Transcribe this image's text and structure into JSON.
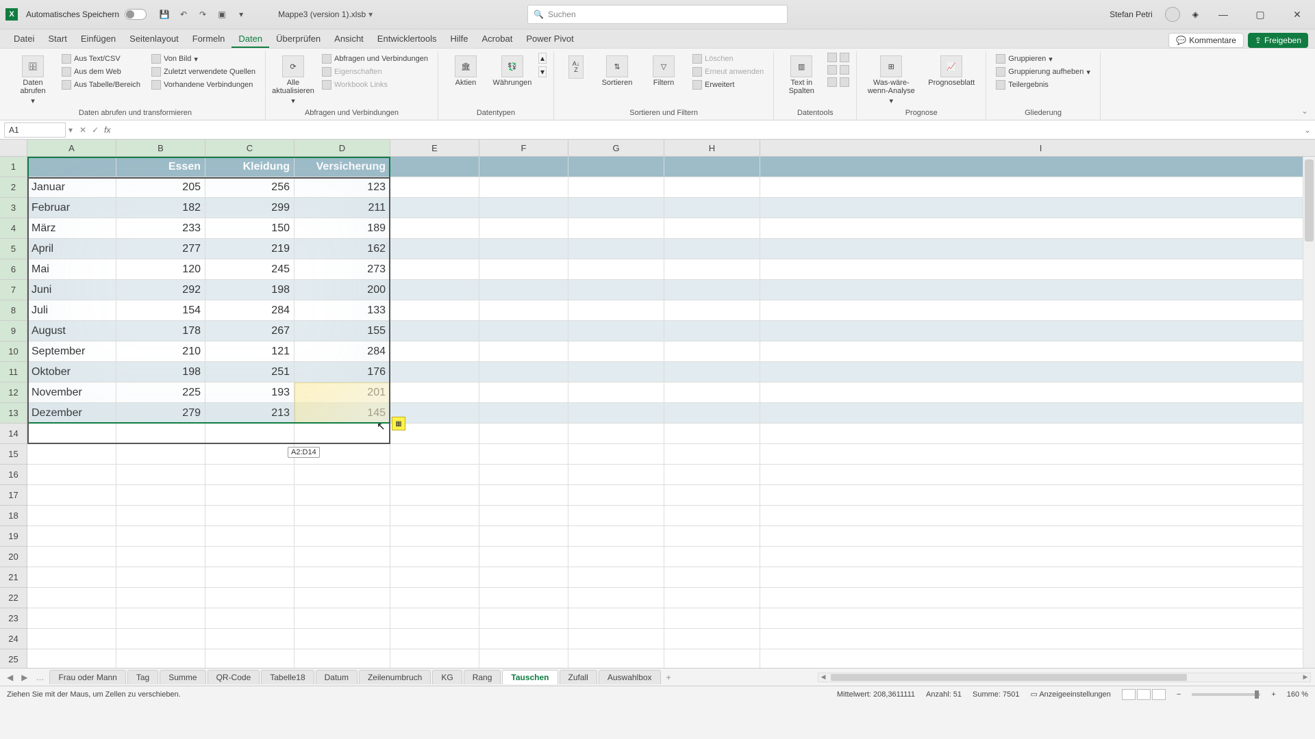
{
  "title": {
    "autosave": "Automatisches Speichern",
    "filename": "Mappe3 (version 1).xlsb",
    "search_placeholder": "Suchen",
    "user": "Stefan Petri"
  },
  "tabs": [
    "Datei",
    "Start",
    "Einfügen",
    "Seitenlayout",
    "Formeln",
    "Daten",
    "Überprüfen",
    "Ansicht",
    "Entwicklertools",
    "Hilfe",
    "Acrobat",
    "Power Pivot"
  ],
  "active_tab": "Daten",
  "tabs_right": {
    "comments": "Kommentare",
    "share": "Freigeben"
  },
  "ribbon": {
    "g1": {
      "big": "Daten abrufen",
      "items": [
        "Aus Text/CSV",
        "Aus dem Web",
        "Aus Tabelle/Bereich"
      ],
      "label": "Daten abrufen und transformieren",
      "items2": [
        "Von Bild",
        "Zuletzt verwendete Quellen",
        "Vorhandene Verbindungen"
      ]
    },
    "g2": {
      "big": "Alle aktualisieren",
      "items": [
        "Abfragen und Verbindungen",
        "Eigenschaften",
        "Workbook Links"
      ],
      "label": "Abfragen und Verbindungen"
    },
    "g3": {
      "btn1": "Aktien",
      "btn2": "Währungen",
      "label": "Datentypen"
    },
    "g4": {
      "btn1": "Sortieren",
      "btn2": "Filtern",
      "items": [
        "Löschen",
        "Erneut anwenden",
        "Erweitert"
      ],
      "label": "Sortieren und Filtern"
    },
    "g5": {
      "big": "Text in Spalten",
      "label": "Datentools"
    },
    "g6": {
      "btn1": "Was-wäre-wenn-Analyse",
      "btn2": "Prognoseblatt",
      "label": "Prognose"
    },
    "g7": {
      "items": [
        "Gruppieren",
        "Gruppierung aufheben",
        "Teilergebnis"
      ],
      "label": "Gliederung"
    }
  },
  "formula": {
    "name_box": "A1",
    "fx": "fx"
  },
  "grid": {
    "col_widths": {
      "A": 130,
      "B": 130,
      "C": 130,
      "D": 140,
      "E": 130,
      "F": 130,
      "G": 140,
      "H": 140,
      "I": 820
    },
    "cols": [
      "A",
      "B",
      "C",
      "D",
      "E",
      "F",
      "G",
      "H",
      "I"
    ],
    "selected_cols": [
      "A",
      "B",
      "C",
      "D"
    ],
    "rows": 26,
    "selected_rows": [
      1,
      2,
      3,
      4,
      5,
      6,
      7,
      8,
      9,
      10,
      11,
      12,
      13
    ],
    "headers": [
      "",
      "Essen",
      "Kleidung",
      "Versicherung"
    ],
    "data": [
      [
        "Januar",
        "205",
        "256",
        "123"
      ],
      [
        "Februar",
        "182",
        "299",
        "211"
      ],
      [
        "März",
        "233",
        "150",
        "189"
      ],
      [
        "April",
        "277",
        "219",
        "162"
      ],
      [
        "Mai",
        "120",
        "245",
        "273"
      ],
      [
        "Juni",
        "292",
        "198",
        "200"
      ],
      [
        "Juli",
        "154",
        "284",
        "133"
      ],
      [
        "August",
        "178",
        "267",
        "155"
      ],
      [
        "September",
        "210",
        "121",
        "284"
      ],
      [
        "Oktober",
        "198",
        "251",
        "176"
      ],
      [
        "November",
        "225",
        "193",
        "201"
      ],
      [
        "Dezember",
        "279",
        "213",
        "145"
      ]
    ],
    "drag_tip": "A2:D14"
  },
  "sheets": {
    "tabs": [
      "Frau oder Mann",
      "Tag",
      "Summe",
      "QR-Code",
      "Tabelle18",
      "Datum",
      "Zeilenumbruch",
      "KG",
      "Rang",
      "Tauschen",
      "Zufall",
      "Auswahlbox"
    ],
    "active": "Tauschen",
    "add": "+"
  },
  "status": {
    "msg": "Ziehen Sie mit der Maus, um Zellen zu verschieben.",
    "avg": "Mittelwert: 208,3611111",
    "count": "Anzahl: 51",
    "sum": "Summe: 7501",
    "acc": "Anzeigeeinstellungen",
    "zoom": "160 %"
  }
}
